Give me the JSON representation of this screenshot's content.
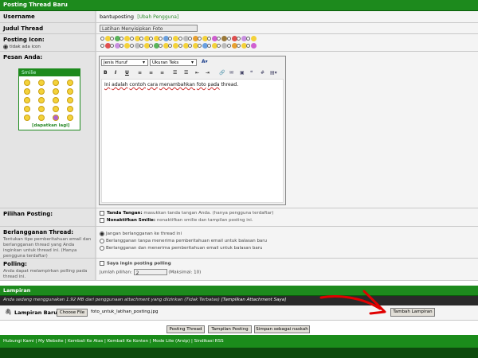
{
  "header": {
    "title": "Posting Thread Baru"
  },
  "username": {
    "label": "Username",
    "value": "bantuposting",
    "change_link": "[Ubah Pengguna]"
  },
  "title": {
    "label": "Judul Thread",
    "value": "Latihan Menyisipkan Foto"
  },
  "icon": {
    "label": "Posting Icon:",
    "none_label": "tidak ada icon"
  },
  "message": {
    "label": "Pesan Anda:"
  },
  "smilies": {
    "header": "Smilie",
    "more_link": "[dapatkan lagi]"
  },
  "editor": {
    "font_select": "Jenis Huruf",
    "size_select": "Ukuran Teks",
    "text_words": [
      "Ini",
      "adalah",
      "contoh",
      "cara",
      "menambahkan",
      "foto",
      "pada",
      "thread."
    ]
  },
  "options": {
    "label": "Pilihan Posting:",
    "signature_label": "Tanda Tangan:",
    "signature_desc": "masukkan tanda tangan Anda. (hanya pengguna terdaftar)",
    "smilie_label": "Nonaktifkan Smilie:",
    "smilie_desc": "nonaktifkan smilie dan tampilan posting ini."
  },
  "subscribe": {
    "label": "Berlangganan Thread:",
    "desc": "Tentukan tipe pemberitahuan email dan berlangganan thread yang Anda inginkan untuk thread ini. (Hanya pengguna terdaftar)",
    "opt1": "Jangan berlangganan ke thread ini",
    "opt2": "Berlangganan tanpa menerima pemberitahuan email untuk balasan baru",
    "opt3": "Berlangganan dan menerima pemberitahuan email untuk balasan baru"
  },
  "polling": {
    "label": "Polling:",
    "desc": "Anda dapat melampirkan polling pada thread ini.",
    "check_label": "Saya ingin posting polling",
    "count_label": "Jumlah pilihan:",
    "count_value": "2",
    "max_label": "(Maksimal: 10)"
  },
  "attachment": {
    "header": "Lampiran",
    "info": "Anda sedang menggunakan 1.92 MB dari penggunaan attachment yang diizinkan (Tidak Terbatas)",
    "info_link": "[Tampilkan Attachment Saya]",
    "label": "Lampiran Baru:",
    "choose_label": "Choose File",
    "file_name": "foto_untuk_latihan_posting.jpg",
    "add_button": "Tambah Lampiran"
  },
  "actions": {
    "post": "Posting Thread",
    "preview": "Tampilan Posting",
    "draft": "Simpan sebagai naskah"
  },
  "footer": {
    "links": [
      "Hubungi Kami",
      "My Website",
      "Kembali Ke Atas",
      "Kembali Ke Konten",
      "Mode Lite (Arsip)",
      "Sindikasi RSS"
    ]
  },
  "colors": {
    "header_green": "#1d8a1d",
    "arrow_red": "#e00000"
  }
}
